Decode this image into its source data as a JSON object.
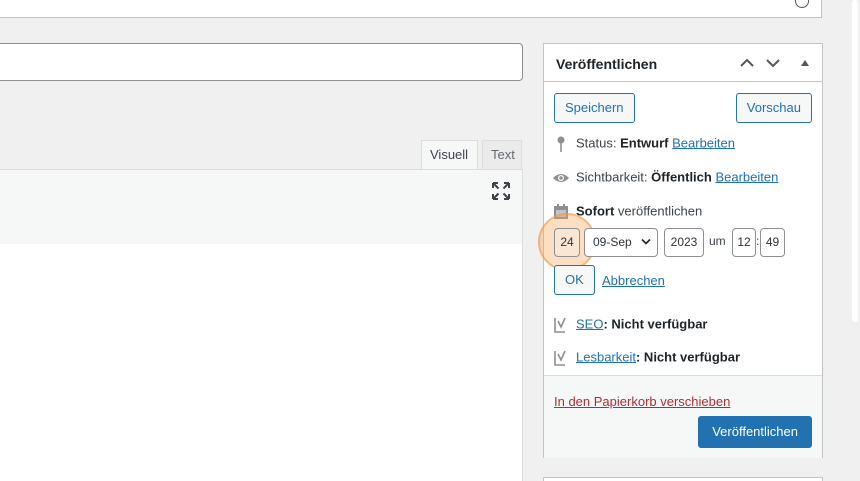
{
  "editor": {
    "title_value": "",
    "tabs": [
      {
        "label": "Visuell"
      },
      {
        "label": "Text"
      }
    ]
  },
  "publish": {
    "title": "Veröffentlichen",
    "save_label": "Speichern",
    "preview_label": "Vorschau",
    "status": {
      "label": "Status:",
      "value": "Entwurf",
      "edit": "Bearbeiten"
    },
    "visibility": {
      "label": "Sichtbarkeit:",
      "value": "Öffentlich",
      "edit": "Bearbeiten"
    },
    "schedule": {
      "value": "Sofort",
      "suffix": "veröffentlichen"
    },
    "date": {
      "day": "24",
      "month": "09-Sep",
      "year": "2023",
      "at": "um",
      "hour": "12",
      "colon": ":",
      "minute": "49"
    },
    "ok_label": "OK",
    "cancel_label": "Abbrechen",
    "seo": {
      "link": "SEO",
      "value": ": Nicht verfügbar"
    },
    "readability": {
      "link": "Lesbarkeit",
      "value": ": Nicht verfügbar"
    },
    "trash_label": "In den Papierkorb verschieben",
    "publish_label": "Veröffentlichen"
  },
  "colors": {
    "accent": "#2271b1",
    "danger": "#b32d2e",
    "highlight": "#f5a050"
  }
}
